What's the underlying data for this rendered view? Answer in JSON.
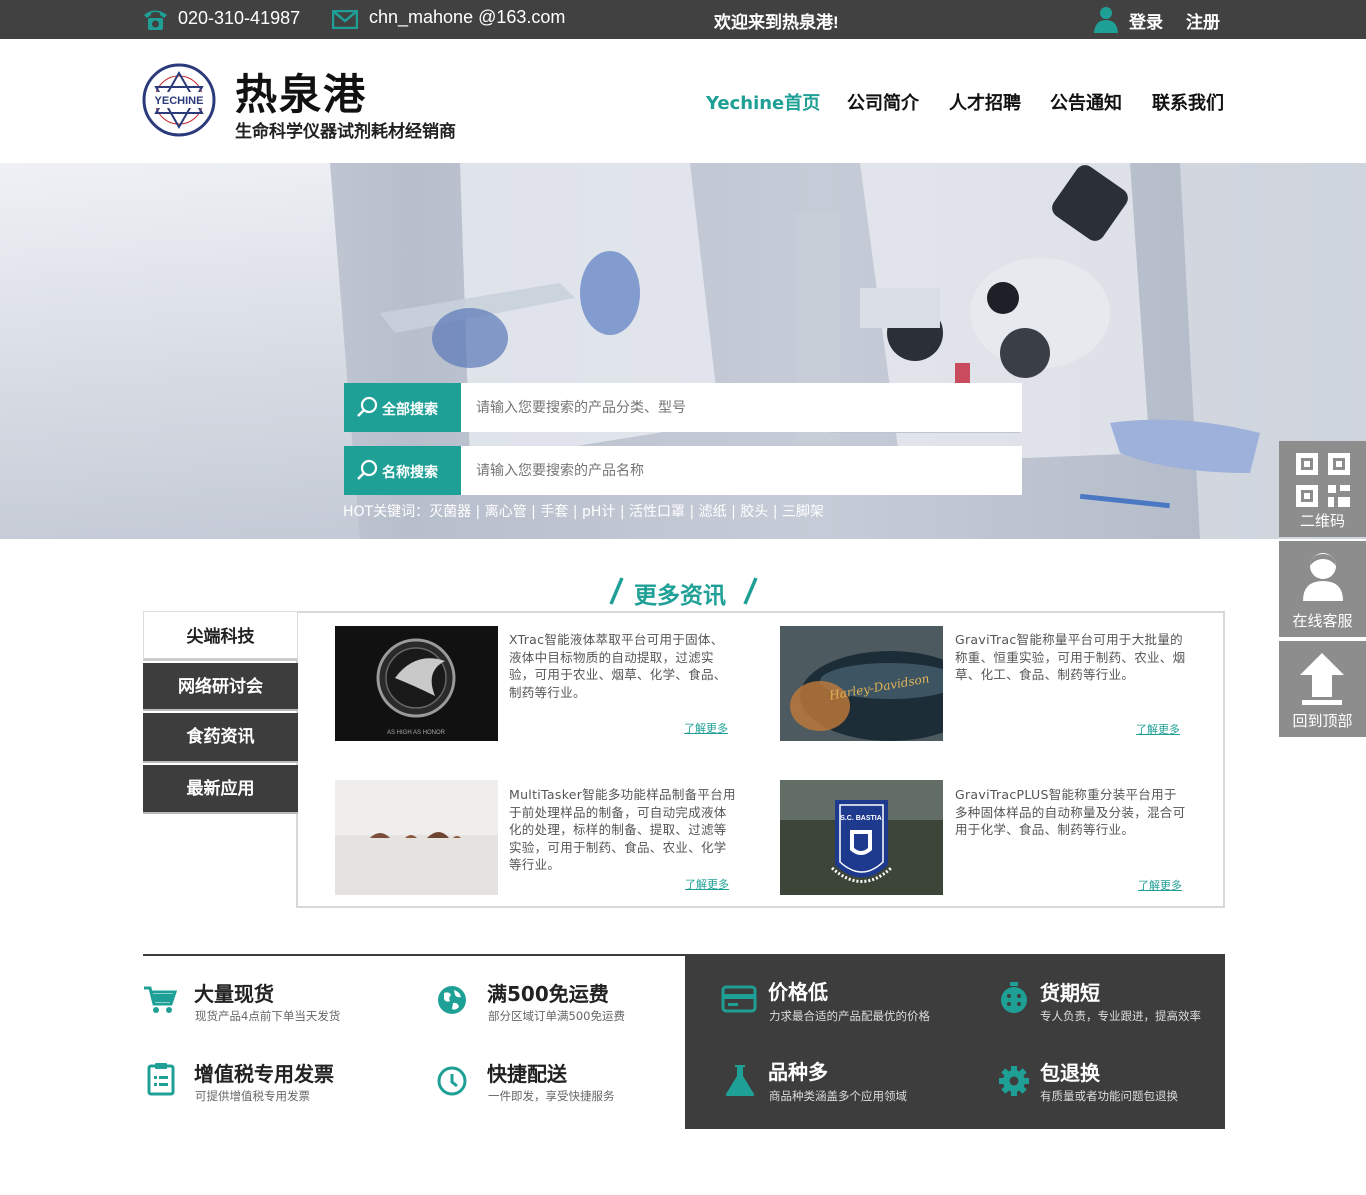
{
  "topbar": {
    "phone": "020-310-41987",
    "email": "chn_mahone @163.com",
    "welcome": "欢迎来到热泉港!",
    "login": "登录",
    "register": "注册"
  },
  "brand": {
    "logo_text": "YECHINE",
    "logo_ring": "C G A T T C A G A C G T",
    "name": "热泉港",
    "slogan": "生命科学仪器试剂耗材经销商"
  },
  "nav": [
    "Yechine首页",
    "公司简介",
    "人才招聘",
    "公告通知",
    "联系我们"
  ],
  "search": [
    {
      "button": "全部搜索",
      "placeholder": "请输入您要搜索的产品分类、型号"
    },
    {
      "button": "名称搜索",
      "placeholder": "请输入您要搜索的产品名称"
    }
  ],
  "hot": {
    "label": "HOT关键词：",
    "keywords": [
      "灭菌器",
      "离心管",
      "手套",
      "pH计",
      "活性口罩",
      "滤纸",
      "胶头",
      "三脚架"
    ]
  },
  "news_section": {
    "title": "更多资讯",
    "tabs": [
      "尖端科技",
      "网络研讨会",
      "食药资讯",
      "最新应用"
    ],
    "items": [
      {
        "text": "XTrac智能液体萃取平台可用于固体、液体中目标物质的自动提取，过滤实验，可用于农业、烟草、化学、食品、制药等行业。",
        "more": "了解更多",
        "img_caption": "AS HIGH AS HONOR"
      },
      {
        "text": "GraviTrac智能称量平台可用于大批量的称重、恒重实验，可用于制药、农业、烟草、化工、食品、制药等行业。",
        "more": "了解更多",
        "img_caption": "Harley-Davidson"
      },
      {
        "text": "MultiTasker智能多功能样品制备平台用于前处理样品的制备，可自动完成液体化的处理，标样的制备、提取、过滤等实验，可用于制药、食品、农业、化学等行业。",
        "more": "了解更多",
        "img_caption": ""
      },
      {
        "text": "GraviTracPLUS智能称重分装平台用于多种固体样品的自动称量及分装，混合可用于化学、食品、制药等行业。",
        "more": "了解更多",
        "img_caption": "S.C. BASTIA"
      }
    ]
  },
  "features_left": [
    {
      "icon": "cart-icon",
      "title": "大量现货",
      "sub": "现货产品4点前下单当天发货"
    },
    {
      "icon": "globe-icon",
      "title": "满500免运费",
      "sub": "部分区域订单满500免运费"
    },
    {
      "icon": "clipboard-icon",
      "title": "增值税专用发票",
      "sub": "可提供增值税专用发票"
    },
    {
      "icon": "clock-icon",
      "title": "快捷配送",
      "sub": "一件即发，享受快捷服务"
    }
  ],
  "features_right": [
    {
      "icon": "card-icon",
      "title": "价格低",
      "sub": "力求最合适的产品配最优的价格"
    },
    {
      "icon": "stopwatch-icon",
      "title": "货期短",
      "sub": "专人负责，专业跟进，提高效率"
    },
    {
      "icon": "flask-icon",
      "title": "品种多",
      "sub": "商品种类涵盖多个应用领域"
    },
    {
      "icon": "gear-icon",
      "title": "包退换",
      "sub": "有质量或者功能问题包退换"
    }
  ],
  "sidebar": {
    "qr": "二维码",
    "service": "在线客服",
    "top": "回到顶部"
  },
  "colors": {
    "accent": "#1fa096",
    "dark": "#3d3d3d",
    "topbar": "#414141"
  }
}
